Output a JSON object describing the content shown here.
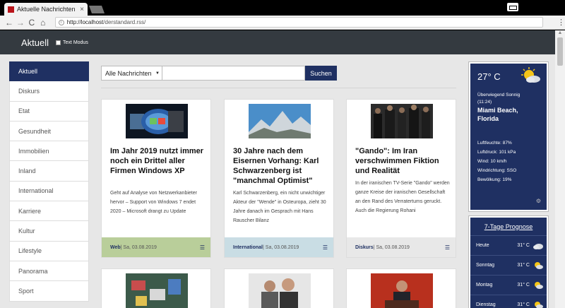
{
  "browser": {
    "tab_title": "Aktuelle Nachrichten | de",
    "tab_close": "×",
    "nav_back": "←",
    "nav_forward": "→",
    "nav_reload": "C",
    "nav_home": "⌂",
    "url_host": "http://localhost",
    "url_path": "/derstandard.rss/",
    "menu": "⋮"
  },
  "navbar": {
    "brand": "Aktuell",
    "text_mode_label": "Text Modus"
  },
  "sidebar": {
    "items": [
      {
        "label": "Aktuell"
      },
      {
        "label": "Diskurs"
      },
      {
        "label": "Etat"
      },
      {
        "label": "Gesundheit"
      },
      {
        "label": "Immobilien"
      },
      {
        "label": "Inland"
      },
      {
        "label": "International"
      },
      {
        "label": "Karriere"
      },
      {
        "label": "Kultur"
      },
      {
        "label": "Lifestyle"
      },
      {
        "label": "Panorama"
      },
      {
        "label": "Sport"
      }
    ]
  },
  "search": {
    "selected": "Alle Nachrichten",
    "button": "Suchen"
  },
  "articles": [
    {
      "title": "Im Jahr 2019 nutzt immer noch ein Drittel aller Firmen Windows XP",
      "text": "Geht auf Analyse von Netzwerkanbieter hervor – Support von Windows 7 endet 2020 – Microsoft drangt zu Update",
      "category": "Web",
      "date": " | Sa, 03.08.2019",
      "footer_color": "#b9ce9a"
    },
    {
      "title": "30 Jahre nach dem Eisernen Vorhang: Karl Schwarzenberg ist \"manchmal Optimist\"",
      "text": "Karl Schwarzenberg, ein nicht unwichtiger Akteur der \"Wende\" in Osteuropa, zieht 30 Jahre danach im Gesprach mit Hans Rauscher Bilanz",
      "category": "International",
      "date": " | Sa, 03.08.2019",
      "footer_color": "#c9dde4"
    },
    {
      "title": "\"Gando\": Im Iran verschwimmen Fiktion und Realität",
      "text": "In der iranischen TV-Serie \"Gando\" werden ganze Kreise der iranischen Gesellschaft an den Rand des Verratertums geruckt. Auch die Regierung Rohani",
      "category": "Diskurs",
      "date": " | Sa, 03.08.2019",
      "footer_color": "#e8e8e8"
    }
  ],
  "weather": {
    "temperature": "27° C",
    "condition": "Überwiegend Sonnig",
    "time": "(11:24)",
    "city_line1": "Miami Beach,",
    "city_line2": "Florida",
    "humidity": "Luftfeuchte: 87%",
    "pressure": "Luftdruck: 101 kPa",
    "wind": "Wind: 10 km/h",
    "wind_direction": "Windrichtung: SSO",
    "clouds": "Bewölkung: 19%",
    "gear": "⚙"
  },
  "forecast": {
    "title": "7-Tage Prognose",
    "days": [
      {
        "day": "Heute",
        "temp": "31° C"
      },
      {
        "day": "Sonntag",
        "temp": "31° C"
      },
      {
        "day": "Montag",
        "temp": "31° C"
      },
      {
        "day": "Dienstag",
        "temp": "31° C"
      }
    ]
  },
  "icons": {
    "sun_cloud": "sun-cloud-icon",
    "list": "list-icon",
    "search_info": "info-icon"
  },
  "colors": {
    "primary": "#1f3062",
    "navbar": "#343a40"
  }
}
